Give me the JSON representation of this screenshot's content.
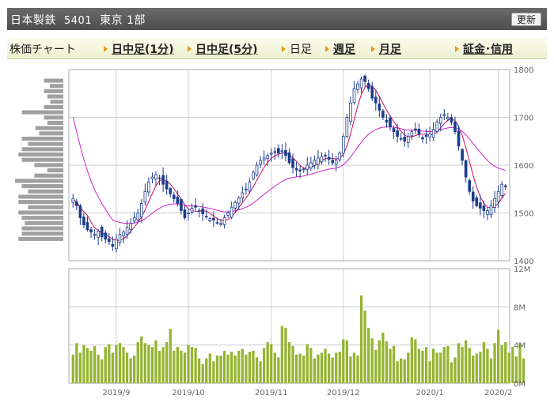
{
  "header": {
    "company": "日本製鉄",
    "code": "5401",
    "market": "東京 1部",
    "refresh_label": "更新"
  },
  "tabs": [
    {
      "label": "株価チャート",
      "arrow": false,
      "link": false
    },
    {
      "label": "日中足(1分)",
      "arrow": true,
      "link": true
    },
    {
      "label": "日中足(5分)",
      "arrow": true,
      "link": true
    },
    {
      "label": "日足",
      "arrow": true,
      "link": false
    },
    {
      "label": "週足",
      "arrow": true,
      "link": true
    },
    {
      "label": "月足",
      "arrow": true,
      "link": true
    },
    {
      "label": "証金･信用",
      "arrow": true,
      "link": true
    }
  ],
  "colors": {
    "up": "#ffffff",
    "down": "#1c3c8c",
    "ma_short": "#cc0a62",
    "ma_long": "#cc22cc",
    "volume": "#94b431",
    "profile": "#a0a0a0",
    "grid": "#cccccc"
  },
  "chart_data": {
    "type": "candlestick",
    "price_axis": {
      "min": 1400,
      "max": 1800,
      "ticks": [
        1400,
        1500,
        1600,
        1700,
        1800
      ]
    },
    "volume_axis": {
      "min": 0,
      "max": 12,
      "unit": "M",
      "ticks": [
        "0M",
        "4M",
        "8M",
        "12M"
      ]
    },
    "x_labels": [
      "2019/9",
      "2019/10",
      "2019/11",
      "2019/12",
      "2020/1",
      "2020/2"
    ],
    "x_label_index": [
      12,
      32,
      55,
      75,
      99,
      118
    ],
    "closes": [
      1530,
      1515,
      1490,
      1475,
      1465,
      1460,
      1455,
      1462,
      1450,
      1445,
      1440,
      1430,
      1445,
      1455,
      1460,
      1470,
      1478,
      1490,
      1500,
      1520,
      1545,
      1565,
      1575,
      1580,
      1572,
      1560,
      1550,
      1540,
      1530,
      1520,
      1505,
      1490,
      1500,
      1510,
      1512,
      1505,
      1498,
      1492,
      1488,
      1485,
      1480,
      1478,
      1490,
      1500,
      1512,
      1522,
      1532,
      1542,
      1550,
      1565,
      1585,
      1600,
      1610,
      1615,
      1620,
      1625,
      1628,
      1625,
      1630,
      1620,
      1605,
      1595,
      1590,
      1588,
      1592,
      1600,
      1605,
      1610,
      1615,
      1618,
      1620,
      1612,
      1605,
      1610,
      1625,
      1660,
      1700,
      1730,
      1760,
      1770,
      1780,
      1775,
      1760,
      1740,
      1730,
      1715,
      1700,
      1690,
      1680,
      1670,
      1660,
      1655,
      1650,
      1660,
      1670,
      1675,
      1665,
      1655,
      1660,
      1665,
      1675,
      1690,
      1700,
      1705,
      1700,
      1690,
      1670,
      1640,
      1610,
      1575,
      1545,
      1525,
      1515,
      1510,
      1505,
      1505,
      1515,
      1530,
      1545,
      1560,
      1555
    ],
    "volumes": [
      3.0,
      4.2,
      3.2,
      4.0,
      3.7,
      3.4,
      3.9,
      3.0,
      2.5,
      3.8,
      4.1,
      3.2,
      4.0,
      4.2,
      3.8,
      3.2,
      2.6,
      2.9,
      4.3,
      4.9,
      4.2,
      4.0,
      3.8,
      4.5,
      3.4,
      3.8,
      4.3,
      5.7,
      3.4,
      3.8,
      3.4,
      3.2,
      4.0,
      3.8,
      3.7,
      2.6,
      2.0,
      2.6,
      3.1,
      2.3,
      2.9,
      2.9,
      3.4,
      3.0,
      3.3,
      2.9,
      3.4,
      3.6,
      3.0,
      3.3,
      3.4,
      2.7,
      2.3,
      3.7,
      4.3,
      4.1,
      3.2,
      2.7,
      6.0,
      5.8,
      4.3,
      3.9,
      3.0,
      3.1,
      2.9,
      4.1,
      3.7,
      2.6,
      3.0,
      3.2,
      3.6,
      3.1,
      2.7,
      3.2,
      3.3,
      4.6,
      4.5,
      2.8,
      3.2,
      2.9,
      9.2,
      7.6,
      5.8,
      4.7,
      3.5,
      4.5,
      5.3,
      4.4,
      3.6,
      3.9,
      2.3,
      2.6,
      2.5,
      3.2,
      4.8,
      4.6,
      3.6,
      3.4,
      3.8,
      2.3,
      3.6,
      3.2,
      3.2,
      3.8,
      3.9,
      2.2,
      2.7,
      4.2,
      3.8,
      4.5,
      3.7,
      2.9,
      3.1,
      3.3,
      4.3,
      3.6,
      2.6,
      4.2,
      5.6,
      4.0,
      4.3,
      3.2,
      3.8,
      2.8,
      4.2,
      2.6
    ],
    "volume_profile": [
      0.4,
      0.28,
      0.4,
      0.33,
      0.27,
      0.4,
      0.86,
      0.4,
      0.33,
      0.58,
      0.5,
      0.86,
      0.73,
      0.86,
      0.93,
      0.86,
      0.6,
      0.33,
      0.6,
      1.0,
      0.86,
      0.73,
      0.93,
      0.93,
      0.73,
      0.93,
      0.86,
      0.8,
      0.86,
      0.86,
      0.93
    ],
    "ma_short_window": 5,
    "ma_long_window": 25
  }
}
